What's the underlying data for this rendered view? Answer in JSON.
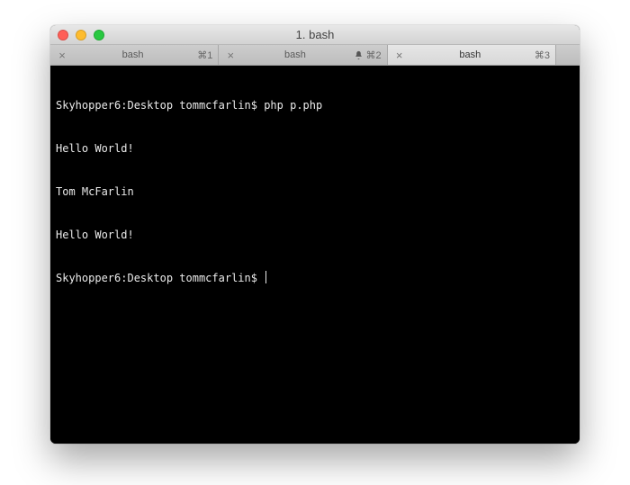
{
  "window": {
    "title": "1. bash"
  },
  "tabs": [
    {
      "label": "bash",
      "shortcut": "⌘1",
      "active": false,
      "notify": false
    },
    {
      "label": "bash",
      "shortcut": "⌘2",
      "active": false,
      "notify": true
    },
    {
      "label": "bash",
      "shortcut": "⌘3",
      "active": true,
      "notify": false
    }
  ],
  "terminal": {
    "prompt": "Skyhopper6:Desktop tommcfarlin$",
    "command": "php p.php",
    "output": [
      "Hello World!",
      "Tom McFarlin",
      "Hello World!"
    ]
  }
}
